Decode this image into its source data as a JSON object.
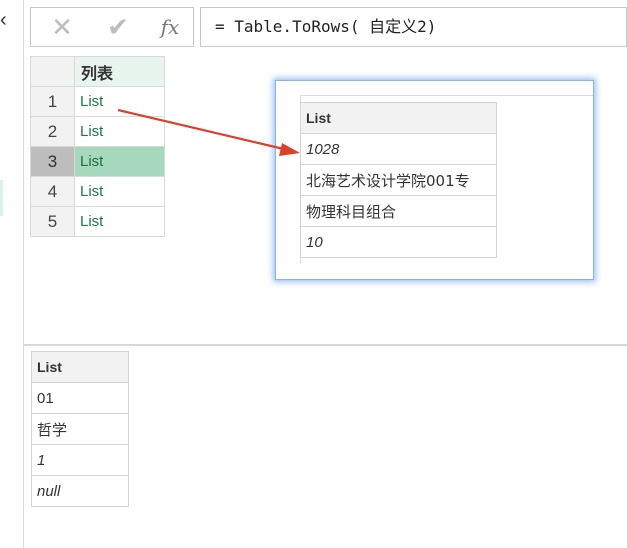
{
  "formula_bar": {
    "cancel_icon": "close-icon",
    "commit_icon": "checkmark-icon",
    "fx_label": "fx",
    "formula": "= Table.ToRows( 自定义2)"
  },
  "grid": {
    "column_header": "列表",
    "rows": [
      {
        "num": "1",
        "value": "List"
      },
      {
        "num": "2",
        "value": "List"
      },
      {
        "num": "3",
        "value": "List"
      },
      {
        "num": "4",
        "value": "List"
      },
      {
        "num": "5",
        "value": "List"
      }
    ],
    "selected_row": 3
  },
  "preview_popup": {
    "header": "List",
    "rows": [
      "1028",
      "北海艺术设计学院001专",
      "物理科目组合",
      "10"
    ]
  },
  "bottom_preview": {
    "header": "List",
    "rows": [
      "01",
      "哲学",
      "1",
      "null"
    ]
  },
  "colors": {
    "accent_green": "#a5d8bd",
    "list_text_green": "#1e7a47",
    "arrow_red": "#d9412b",
    "popup_glow": "#5a96e6"
  }
}
